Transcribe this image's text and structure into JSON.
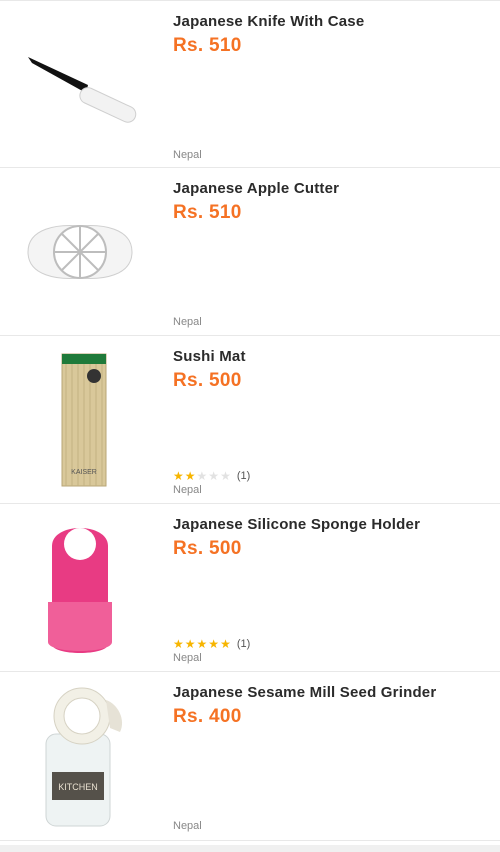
{
  "products": [
    {
      "title": "Japanese Knife With Case",
      "price": "Rs. 510",
      "location": "Nepal",
      "rating_count": "",
      "rating": 0
    },
    {
      "title": "Japanese Apple Cutter",
      "price": "Rs. 510",
      "location": "Nepal",
      "rating_count": "",
      "rating": 0
    },
    {
      "title": "Sushi Mat",
      "price": "Rs. 500",
      "location": "Nepal",
      "rating_count": "(1)",
      "rating": 2
    },
    {
      "title": "Japanese Silicone Sponge Holder",
      "price": "Rs. 500",
      "location": "Nepal",
      "rating_count": "(1)",
      "rating": 5
    },
    {
      "title": "Japanese Sesame Mill Seed Grinder",
      "price": "Rs. 400",
      "location": "Nepal",
      "rating_count": "",
      "rating": 0
    }
  ],
  "colors": {
    "price": "#f57224",
    "star_on": "#f7b500",
    "star_off": "#e2e2e2"
  },
  "package_text": {
    "sushi_mat": "KAISER",
    "grinder": "KITCHEN"
  }
}
